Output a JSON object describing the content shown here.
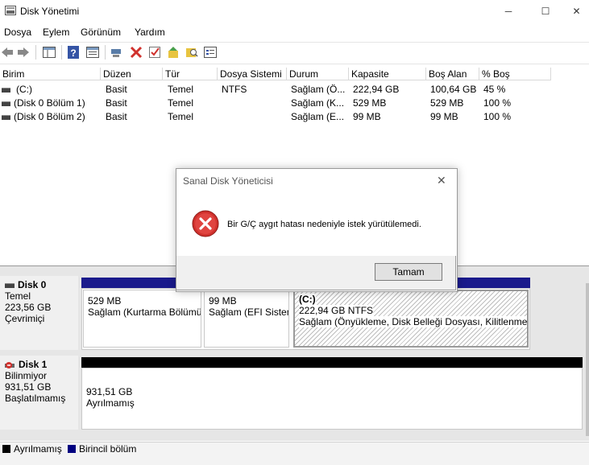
{
  "window": {
    "title": "Disk Yönetimi",
    "minimize": "─",
    "maximize": "☐",
    "close": "✕"
  },
  "menu": [
    "Dosya",
    "Eylem",
    "Görünüm",
    "Yardım"
  ],
  "toolbar": {
    "icons": [
      "back-icon",
      "forward-icon",
      "pane-icon",
      "help-icon",
      "properties-icon",
      "connect-icon",
      "delete-icon",
      "check-icon",
      "import-icon",
      "search-icon",
      "settings-icon"
    ]
  },
  "table": {
    "headers": [
      "Birim",
      "Düzen",
      "Tür",
      "Dosya Sistemi",
      "Durum",
      "Kapasite",
      "Boş Alan",
      "% Boş"
    ],
    "rows": [
      [
        "(C:)",
        "Basit",
        "Temel",
        "NTFS",
        "Sağlam (Ö...",
        "222,94 GB",
        "100,64 GB",
        "45 %"
      ],
      [
        "(Disk 0 Bölüm 1)",
        "Basit",
        "Temel",
        "",
        "Sağlam (K...",
        "529 MB",
        "529 MB",
        "100 %"
      ],
      [
        "(Disk 0 Bölüm 2)",
        "Basit",
        "Temel",
        "",
        "Sağlam (E...",
        "99 MB",
        "99 MB",
        "100 %"
      ]
    ]
  },
  "dialog": {
    "title": "Sanal Disk Yöneticisi",
    "close": "✕",
    "message": "Bir G/Ç aygıt hatası nedeniyle istek yürütülemedi.",
    "ok": "Tamam"
  },
  "disks": [
    {
      "name": "Disk 0",
      "type": "Temel",
      "size": "223,56 GB",
      "status": "Çevrimiçi",
      "partitions": [
        {
          "title": "",
          "size": "529 MB",
          "status": "Sağlam (Kurtarma Bölümü)"
        },
        {
          "title": "",
          "size": "99 MB",
          "status": "Sağlam (EFI Sistem Bölümü)"
        },
        {
          "title": "(C:)",
          "size": "222,94 GB NTFS",
          "status": "Sağlam (Önyükleme, Disk Belleği Dosyası, Kilitlenme Bilgi Dökümü)"
        }
      ]
    },
    {
      "name": "Disk 1",
      "type": "Bilinmiyor",
      "size": "931,51 GB",
      "status": "Başlatılmamış",
      "partitions": [
        {
          "title": "",
          "size": "931,51 GB",
          "status": "Ayrılmamış"
        }
      ]
    }
  ],
  "legend": {
    "unallocated": "Ayrılmamış",
    "primary": "Birincil bölüm",
    "unallocated_color": "#000000",
    "primary_color": "#000080"
  },
  "colors": {
    "primary_bar": "#1a1a8c",
    "unallocated_bar": "#000000",
    "error_red": "#d0312d"
  }
}
